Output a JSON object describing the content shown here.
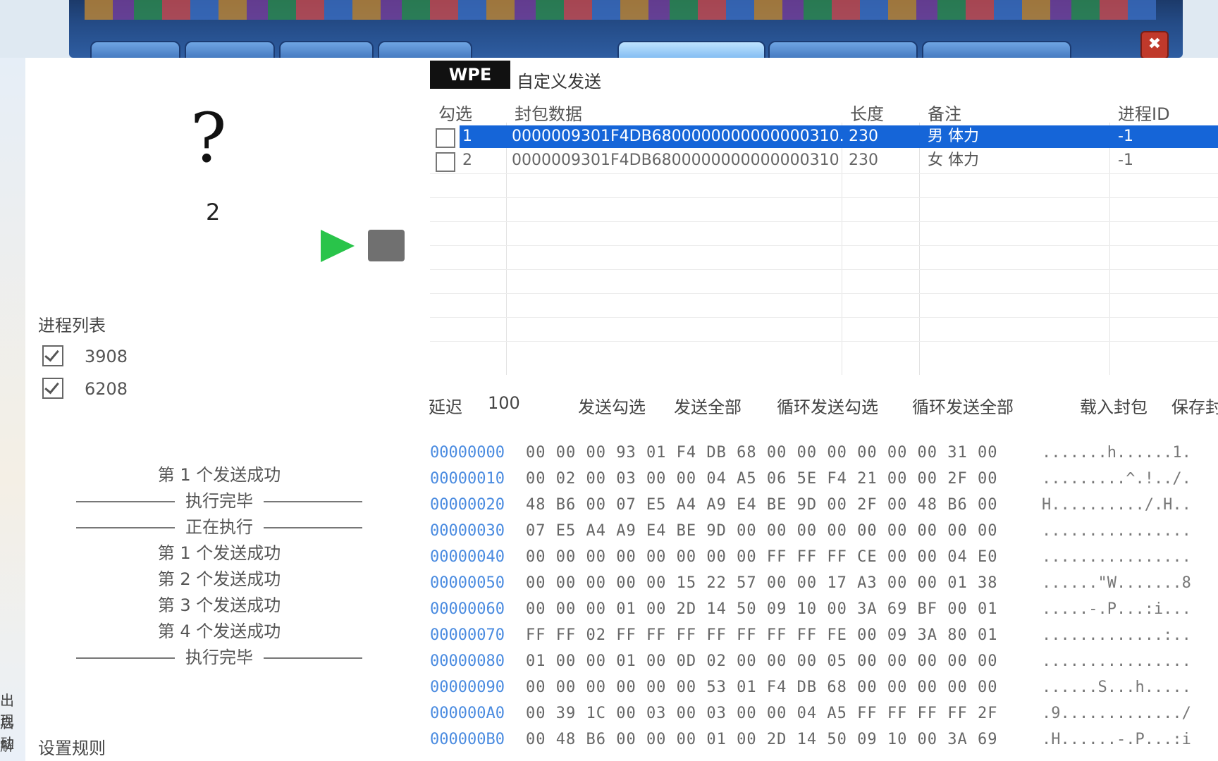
{
  "game": {
    "close_icon": "close-icon"
  },
  "left": {
    "question_mark": "?",
    "count": "2",
    "proc_title": "进程列表",
    "processes": [
      {
        "pid": "3908",
        "checked": true
      },
      {
        "pid": "6208",
        "checked": true
      }
    ],
    "log": [
      {
        "text": "第 1 个发送成功",
        "sep": false
      },
      {
        "text": "执行完毕",
        "sep": true
      },
      {
        "text": "正在执行",
        "sep": true
      },
      {
        "text": "第 1 个发送成功",
        "sep": false
      },
      {
        "text": "第 2 个发送成功",
        "sep": false
      },
      {
        "text": "第 3 个发送成功",
        "sep": false
      },
      {
        "text": "第 4 个发送成功",
        "sep": false
      },
      {
        "text": "执行完毕",
        "sep": true
      }
    ],
    "rule_button": "设置规则"
  },
  "strip_fragments": [
    "出现",
    "启动",
    "解"
  ],
  "wpe": {
    "tab": "WPE",
    "custom_send": "自定义发送",
    "columns": [
      "勾选",
      "封包数据",
      "长度",
      "备注",
      "进程ID"
    ],
    "rows": [
      {
        "idx": "1",
        "data": "0000009301F4DB6800000000000000310...",
        "len": "230",
        "note": "男 体力",
        "pid": "-1",
        "selected": true
      },
      {
        "idx": "2",
        "data": "0000009301F4DB6800000000000000310...",
        "len": "230",
        "note": "女 体力",
        "pid": "-1",
        "selected": false
      }
    ],
    "delay_label": "延迟",
    "delay_value": "100",
    "btn_send_checked": "发送勾选",
    "btn_send_all": "发送全部",
    "btn_loop_checked": "循环发送勾选",
    "btn_loop_all": "循环发送全部",
    "btn_load": "载入封包",
    "btn_save": "保存封"
  },
  "hex": [
    {
      "off": "00000000",
      "bytes": "00 00 00 93 01 F4 DB 68 00 00 00 00 00 00 31 00",
      "asc": ".......h......1."
    },
    {
      "off": "00000010",
      "bytes": "00 02 00 03 00 00 04 A5 06 5E F4 21 00 00 2F 00",
      "asc": ".........^.!../."
    },
    {
      "off": "00000020",
      "bytes": "48 B6 00 07 E5 A4 A9 E4 BE 9D 00 2F 00 48 B6 00",
      "asc": "H........../.H.."
    },
    {
      "off": "00000030",
      "bytes": "07 E5 A4 A9 E4 BE 9D 00 00 00 00 00 00 00 00 00",
      "asc": "................"
    },
    {
      "off": "00000040",
      "bytes": "00 00 00 00 00 00 00 00 FF FF FF CE 00 00 04 E0",
      "asc": "................"
    },
    {
      "off": "00000050",
      "bytes": "00 00 00 00 00 15 22 57 00 00 17 A3 00 00 01 38",
      "asc": "......\"W.......8"
    },
    {
      "off": "00000060",
      "bytes": "00 00 00 01 00 2D 14 50 09 10 00 3A 69 BF 00 01",
      "asc": ".....-.P...:i..."
    },
    {
      "off": "00000070",
      "bytes": "FF FF 02 FF FF FF FF FF FF FF FE 00 09 3A 80 01",
      "asc": ".............:.."
    },
    {
      "off": "00000080",
      "bytes": "01 00 00 01 00 0D 02 00 00 00 05 00 00 00 00 00",
      "asc": "................"
    },
    {
      "off": "00000090",
      "bytes": "00 00 00 00 00 00 53 01 F4 DB 68 00 00 00 00 00",
      "asc": "......S...h....."
    },
    {
      "off": "000000A0",
      "bytes": "00 39 1C 00 03 00 03 00 00 04 A5 FF FF FF FF 2F",
      "asc": ".9............./"
    },
    {
      "off": "000000B0",
      "bytes": "00 48 B6 00 00 00 01 00 2D 14 50 09 10 00 3A 69",
      "asc": ".H......-.P...:i"
    }
  ]
}
